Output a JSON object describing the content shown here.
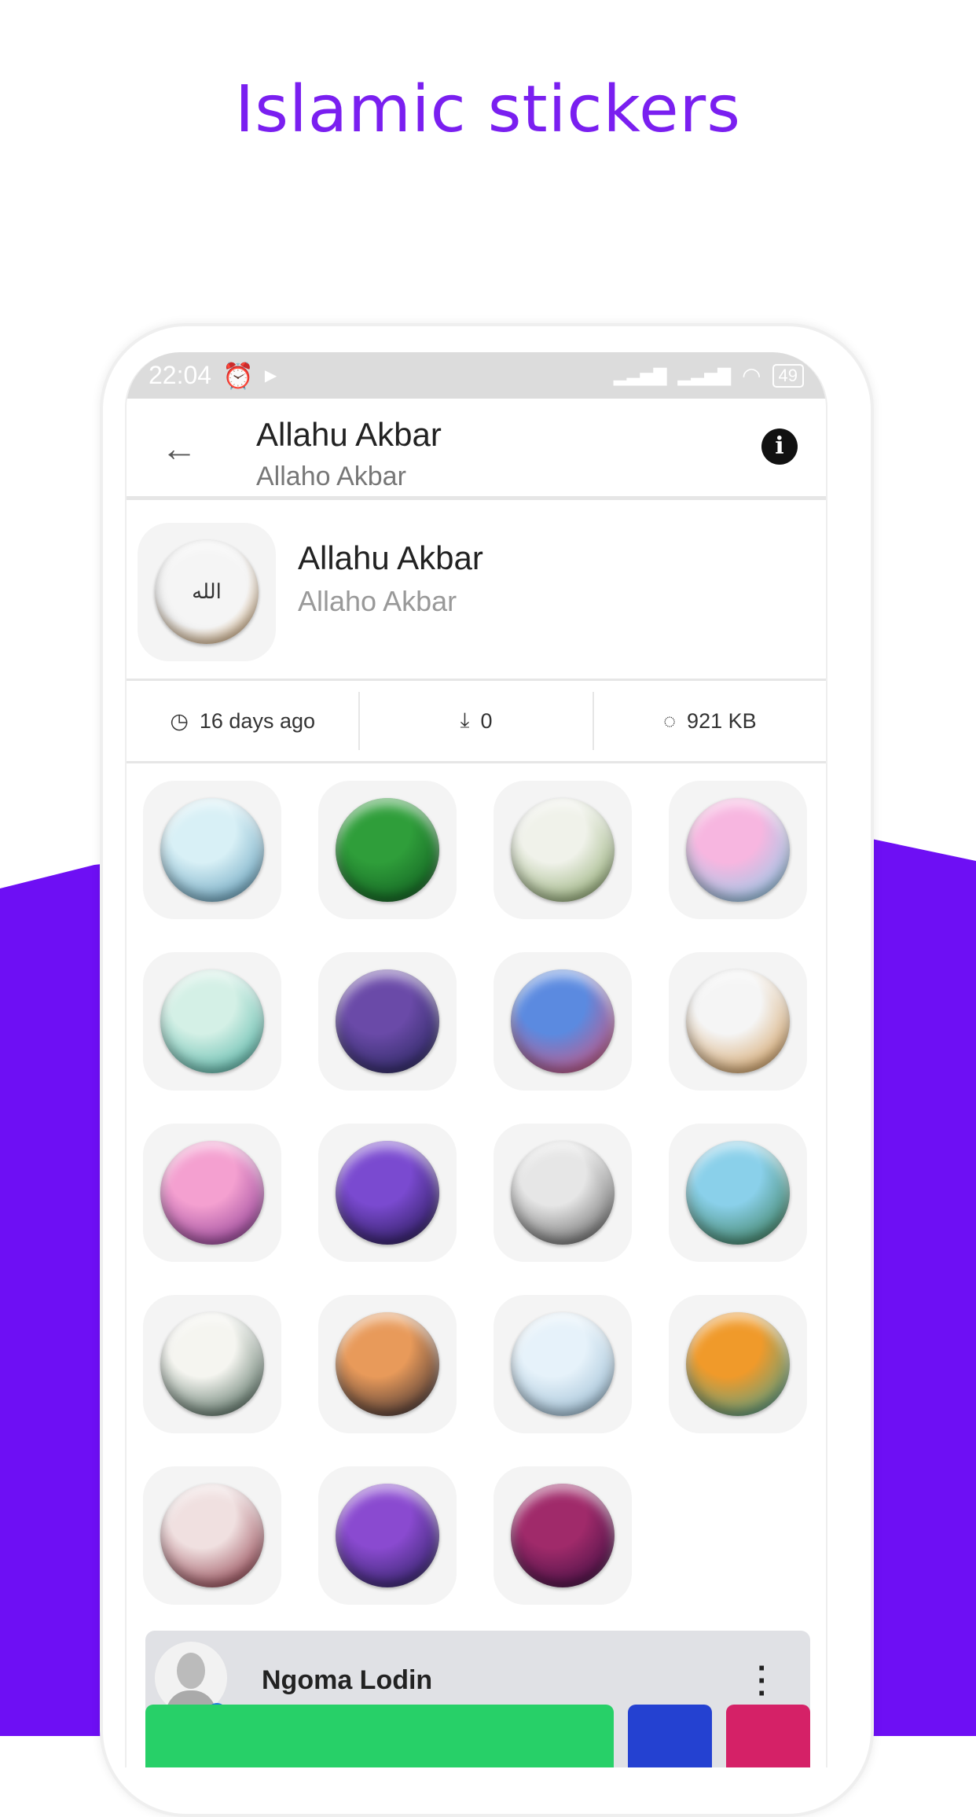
{
  "headline": "Islamic stickers",
  "colors": {
    "headline": "#7a1ff0",
    "background_accent": "#6e0ff4",
    "whatsapp_button": "#27d068",
    "blue_button": "#2441d1",
    "pink_button": "#d52167"
  },
  "status_bar": {
    "time": "22:04",
    "icons": [
      "alarm-icon",
      "play-icon",
      "signal-icon",
      "signal-icon",
      "wifi-icon",
      "battery-icon"
    ],
    "battery": "49"
  },
  "app_bar": {
    "title": "Allahu Akbar",
    "subtitle": "Allaho Akbar",
    "back_icon": "arrow-left-icon",
    "info_icon": "info-icon"
  },
  "pack": {
    "title": "Allahu Akbar",
    "publisher": "Allaho Akbar",
    "tray_colors": [
      "#f5f5f5",
      "#c9893a"
    ]
  },
  "stats": {
    "updated": "16 days ago",
    "downloads": "0",
    "size": "921 KB"
  },
  "stickers": [
    {
      "c1": "#d8f0f6",
      "c2": "#4c8fb0"
    },
    {
      "c1": "#2f9e3a",
      "c2": "#0b4f1c"
    },
    {
      "c1": "#f0f2ea",
      "c2": "#7a9a55"
    },
    {
      "c1": "#f7b6e0",
      "c2": "#7ad0ea"
    },
    {
      "c1": "#d4f0e6",
      "c2": "#3aa99a"
    },
    {
      "c1": "#6a4aa8",
      "c2": "#1a1f4d"
    },
    {
      "c1": "#5b8ae0",
      "c2": "#e8486a"
    },
    {
      "c1": "#f5f5f5",
      "c2": "#c9893a"
    },
    {
      "c1": "#f4a0d0",
      "c2": "#7a2a8a"
    },
    {
      "c1": "#7a4ad0",
      "c2": "#15103a"
    },
    {
      "c1": "#e6e6e6",
      "c2": "#4a4a4a"
    },
    {
      "c1": "#8ad0ea",
      "c2": "#2a6a3a"
    },
    {
      "c1": "#f5f5f0",
      "c2": "#2a4a3a"
    },
    {
      "c1": "#e89a5a",
      "c2": "#1a1a2a"
    },
    {
      "c1": "#e6f2fa",
      "c2": "#8ab0ca"
    },
    {
      "c1": "#f09a2a",
      "c2": "#2aa0a0"
    },
    {
      "c1": "#f0e0e0",
      "c2": "#7a1a2a"
    },
    {
      "c1": "#8a4ad0",
      "c2": "#1a1a4a"
    },
    {
      "c1": "#a02a6a",
      "c2": "#2a0a3a"
    }
  ],
  "card": {
    "name": "Ngoma Lodin"
  }
}
